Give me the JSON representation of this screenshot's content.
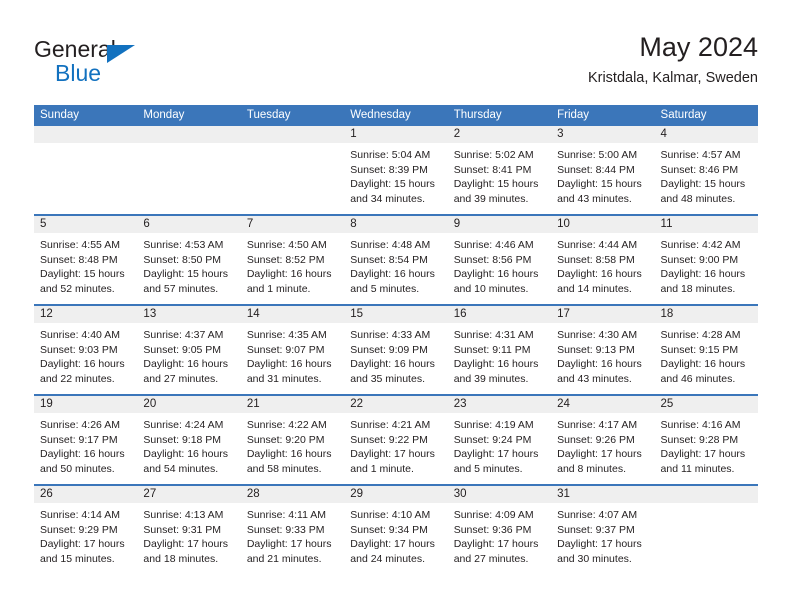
{
  "brand": {
    "line1": "General",
    "line2": "Blue",
    "accent_color": "#1271bf"
  },
  "header": {
    "title": "May 2024",
    "location": "Kristdala, Kalmar, Sweden",
    "header_color": "#3b76ba"
  },
  "weekdays": [
    "Sunday",
    "Monday",
    "Tuesday",
    "Wednesday",
    "Thursday",
    "Friday",
    "Saturday"
  ],
  "weeks": [
    [
      {
        "day": ""
      },
      {
        "day": ""
      },
      {
        "day": ""
      },
      {
        "day": "1",
        "sunrise": "Sunrise: 5:04 AM",
        "sunset": "Sunset: 8:39 PM",
        "daylight": "Daylight: 15 hours and 34 minutes."
      },
      {
        "day": "2",
        "sunrise": "Sunrise: 5:02 AM",
        "sunset": "Sunset: 8:41 PM",
        "daylight": "Daylight: 15 hours and 39 minutes."
      },
      {
        "day": "3",
        "sunrise": "Sunrise: 5:00 AM",
        "sunset": "Sunset: 8:44 PM",
        "daylight": "Daylight: 15 hours and 43 minutes."
      },
      {
        "day": "4",
        "sunrise": "Sunrise: 4:57 AM",
        "sunset": "Sunset: 8:46 PM",
        "daylight": "Daylight: 15 hours and 48 minutes."
      }
    ],
    [
      {
        "day": "5",
        "sunrise": "Sunrise: 4:55 AM",
        "sunset": "Sunset: 8:48 PM",
        "daylight": "Daylight: 15 hours and 52 minutes."
      },
      {
        "day": "6",
        "sunrise": "Sunrise: 4:53 AM",
        "sunset": "Sunset: 8:50 PM",
        "daylight": "Daylight: 15 hours and 57 minutes."
      },
      {
        "day": "7",
        "sunrise": "Sunrise: 4:50 AM",
        "sunset": "Sunset: 8:52 PM",
        "daylight": "Daylight: 16 hours and 1 minute."
      },
      {
        "day": "8",
        "sunrise": "Sunrise: 4:48 AM",
        "sunset": "Sunset: 8:54 PM",
        "daylight": "Daylight: 16 hours and 5 minutes."
      },
      {
        "day": "9",
        "sunrise": "Sunrise: 4:46 AM",
        "sunset": "Sunset: 8:56 PM",
        "daylight": "Daylight: 16 hours and 10 minutes."
      },
      {
        "day": "10",
        "sunrise": "Sunrise: 4:44 AM",
        "sunset": "Sunset: 8:58 PM",
        "daylight": "Daylight: 16 hours and 14 minutes."
      },
      {
        "day": "11",
        "sunrise": "Sunrise: 4:42 AM",
        "sunset": "Sunset: 9:00 PM",
        "daylight": "Daylight: 16 hours and 18 minutes."
      }
    ],
    [
      {
        "day": "12",
        "sunrise": "Sunrise: 4:40 AM",
        "sunset": "Sunset: 9:03 PM",
        "daylight": "Daylight: 16 hours and 22 minutes."
      },
      {
        "day": "13",
        "sunrise": "Sunrise: 4:37 AM",
        "sunset": "Sunset: 9:05 PM",
        "daylight": "Daylight: 16 hours and 27 minutes."
      },
      {
        "day": "14",
        "sunrise": "Sunrise: 4:35 AM",
        "sunset": "Sunset: 9:07 PM",
        "daylight": "Daylight: 16 hours and 31 minutes."
      },
      {
        "day": "15",
        "sunrise": "Sunrise: 4:33 AM",
        "sunset": "Sunset: 9:09 PM",
        "daylight": "Daylight: 16 hours and 35 minutes."
      },
      {
        "day": "16",
        "sunrise": "Sunrise: 4:31 AM",
        "sunset": "Sunset: 9:11 PM",
        "daylight": "Daylight: 16 hours and 39 minutes."
      },
      {
        "day": "17",
        "sunrise": "Sunrise: 4:30 AM",
        "sunset": "Sunset: 9:13 PM",
        "daylight": "Daylight: 16 hours and 43 minutes."
      },
      {
        "day": "18",
        "sunrise": "Sunrise: 4:28 AM",
        "sunset": "Sunset: 9:15 PM",
        "daylight": "Daylight: 16 hours and 46 minutes."
      }
    ],
    [
      {
        "day": "19",
        "sunrise": "Sunrise: 4:26 AM",
        "sunset": "Sunset: 9:17 PM",
        "daylight": "Daylight: 16 hours and 50 minutes."
      },
      {
        "day": "20",
        "sunrise": "Sunrise: 4:24 AM",
        "sunset": "Sunset: 9:18 PM",
        "daylight": "Daylight: 16 hours and 54 minutes."
      },
      {
        "day": "21",
        "sunrise": "Sunrise: 4:22 AM",
        "sunset": "Sunset: 9:20 PM",
        "daylight": "Daylight: 16 hours and 58 minutes."
      },
      {
        "day": "22",
        "sunrise": "Sunrise: 4:21 AM",
        "sunset": "Sunset: 9:22 PM",
        "daylight": "Daylight: 17 hours and 1 minute."
      },
      {
        "day": "23",
        "sunrise": "Sunrise: 4:19 AM",
        "sunset": "Sunset: 9:24 PM",
        "daylight": "Daylight: 17 hours and 5 minutes."
      },
      {
        "day": "24",
        "sunrise": "Sunrise: 4:17 AM",
        "sunset": "Sunset: 9:26 PM",
        "daylight": "Daylight: 17 hours and 8 minutes."
      },
      {
        "day": "25",
        "sunrise": "Sunrise: 4:16 AM",
        "sunset": "Sunset: 9:28 PM",
        "daylight": "Daylight: 17 hours and 11 minutes."
      }
    ],
    [
      {
        "day": "26",
        "sunrise": "Sunrise: 4:14 AM",
        "sunset": "Sunset: 9:29 PM",
        "daylight": "Daylight: 17 hours and 15 minutes."
      },
      {
        "day": "27",
        "sunrise": "Sunrise: 4:13 AM",
        "sunset": "Sunset: 9:31 PM",
        "daylight": "Daylight: 17 hours and 18 minutes."
      },
      {
        "day": "28",
        "sunrise": "Sunrise: 4:11 AM",
        "sunset": "Sunset: 9:33 PM",
        "daylight": "Daylight: 17 hours and 21 minutes."
      },
      {
        "day": "29",
        "sunrise": "Sunrise: 4:10 AM",
        "sunset": "Sunset: 9:34 PM",
        "daylight": "Daylight: 17 hours and 24 minutes."
      },
      {
        "day": "30",
        "sunrise": "Sunrise: 4:09 AM",
        "sunset": "Sunset: 9:36 PM",
        "daylight": "Daylight: 17 hours and 27 minutes."
      },
      {
        "day": "31",
        "sunrise": "Sunrise: 4:07 AM",
        "sunset": "Sunset: 9:37 PM",
        "daylight": "Daylight: 17 hours and 30 minutes."
      },
      {
        "day": ""
      }
    ]
  ]
}
